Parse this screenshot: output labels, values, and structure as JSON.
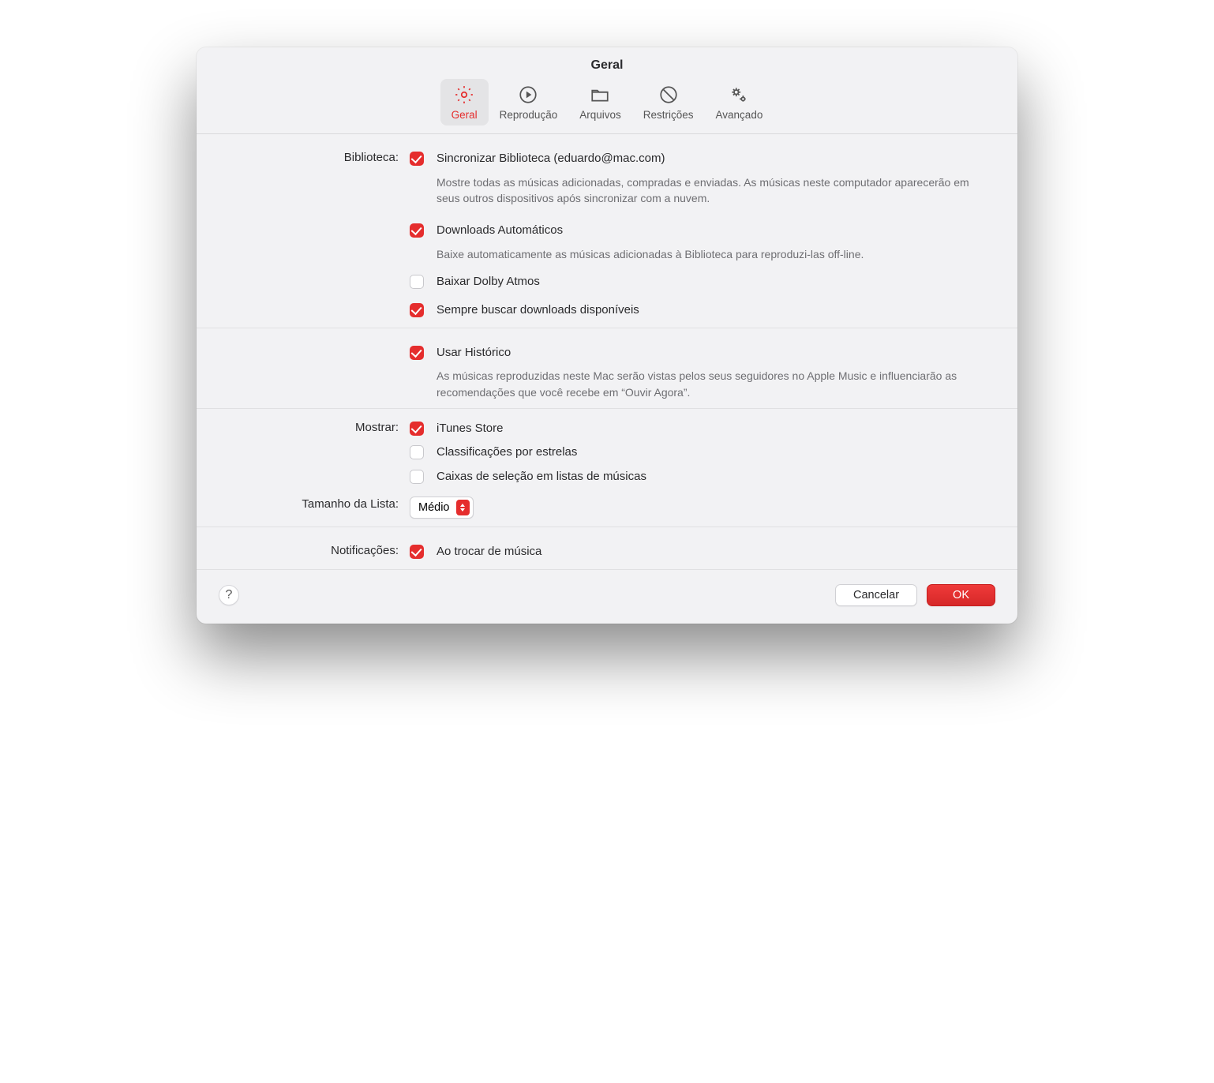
{
  "title": "Geral",
  "toolbar": {
    "items": [
      {
        "label": "Geral",
        "icon": "gear-icon",
        "selected": true
      },
      {
        "label": "Reprodução",
        "icon": "play-icon",
        "selected": false
      },
      {
        "label": "Arquivos",
        "icon": "folder-icon",
        "selected": false
      },
      {
        "label": "Restrições",
        "icon": "prohibit-icon",
        "selected": false
      },
      {
        "label": "Avançado",
        "icon": "gears-icon",
        "selected": false
      }
    ]
  },
  "sections": {
    "library": {
      "label": "Biblioteca:",
      "sync": {
        "checked": true,
        "title": "Sincronizar Biblioteca (eduardo@mac.com)",
        "desc": "Mostre todas as músicas adicionadas, compradas e enviadas. As músicas neste computador aparecerão em seus outros dispositivos após sincronizar com a nuvem."
      },
      "auto_downloads": {
        "checked": true,
        "title": "Downloads Automáticos",
        "desc": "Baixe automaticamente as músicas adicionadas à Biblioteca para reproduzi-las off-line."
      },
      "dolby": {
        "checked": false,
        "title": "Baixar Dolby Atmos"
      },
      "always_fetch": {
        "checked": true,
        "title": "Sempre buscar downloads disponíveis"
      }
    },
    "history": {
      "use_history": {
        "checked": true,
        "title": "Usar Histórico",
        "desc": "As músicas reproduzidas neste Mac serão vistas pelos seus seguidores no Apple Music e influenciarão as recomendações que você recebe em “Ouvir Agora”."
      }
    },
    "show": {
      "label": "Mostrar:",
      "itunes": {
        "checked": true,
        "title": "iTunes Store"
      },
      "star_ratings": {
        "checked": false,
        "title": "Classificações por estrelas"
      },
      "checkboxes_lists": {
        "checked": false,
        "title": "Caixas de seleção em listas de músicas"
      }
    },
    "list_size": {
      "label": "Tamanho da Lista:",
      "value": "Médio"
    },
    "notifications": {
      "label": "Notificações:",
      "on_change": {
        "checked": true,
        "title": "Ao trocar de música"
      }
    }
  },
  "footer": {
    "help": "?",
    "cancel": "Cancelar",
    "ok": "OK"
  }
}
